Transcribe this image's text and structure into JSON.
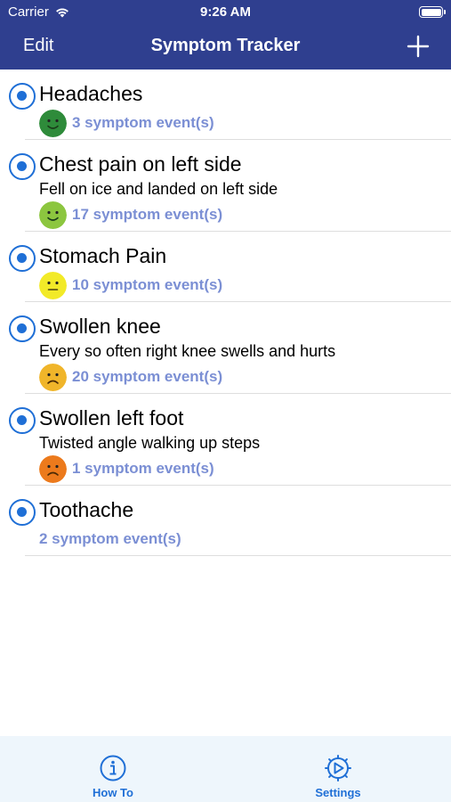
{
  "status_bar": {
    "carrier": "Carrier",
    "time": "9:26 AM"
  },
  "nav": {
    "edit_label": "Edit",
    "title": "Symptom Tracker",
    "add_icon": "plus-icon"
  },
  "symptoms": [
    {
      "title": "Headaches",
      "description": "",
      "count": "3 symptom event(s)",
      "face": "happy",
      "face_color": "#2e8b3a"
    },
    {
      "title": "Chest pain on left side",
      "description": "Fell on ice and landed on left side",
      "count": "17 symptom event(s)",
      "face": "happy",
      "face_color": "#8cc63f"
    },
    {
      "title": "Stomach Pain",
      "description": "",
      "count": "10 symptom event(s)",
      "face": "neutral",
      "face_color": "#f2ea28"
    },
    {
      "title": "Swollen knee",
      "description": "Every so often right knee swells and hurts",
      "count": "20 symptom event(s)",
      "face": "sad",
      "face_color": "#f0b52a"
    },
    {
      "title": "Swollen left foot",
      "description": "Twisted angle walking up steps",
      "count": "1 symptom event(s)",
      "face": "sad",
      "face_color": "#ec7a1c"
    },
    {
      "title": "Toothache",
      "description": "",
      "count": "2 symptom event(s)",
      "face": "none",
      "face_color": ""
    }
  ],
  "tabs": [
    {
      "label": "How To",
      "icon": "info-icon"
    },
    {
      "label": "Settings",
      "icon": "gear-icon"
    }
  ],
  "colors": {
    "nav_bg": "#2f3f8f",
    "accent": "#1f6fd6",
    "count_text": "#7b8fd4",
    "tabbar_bg": "#eef6fc"
  }
}
